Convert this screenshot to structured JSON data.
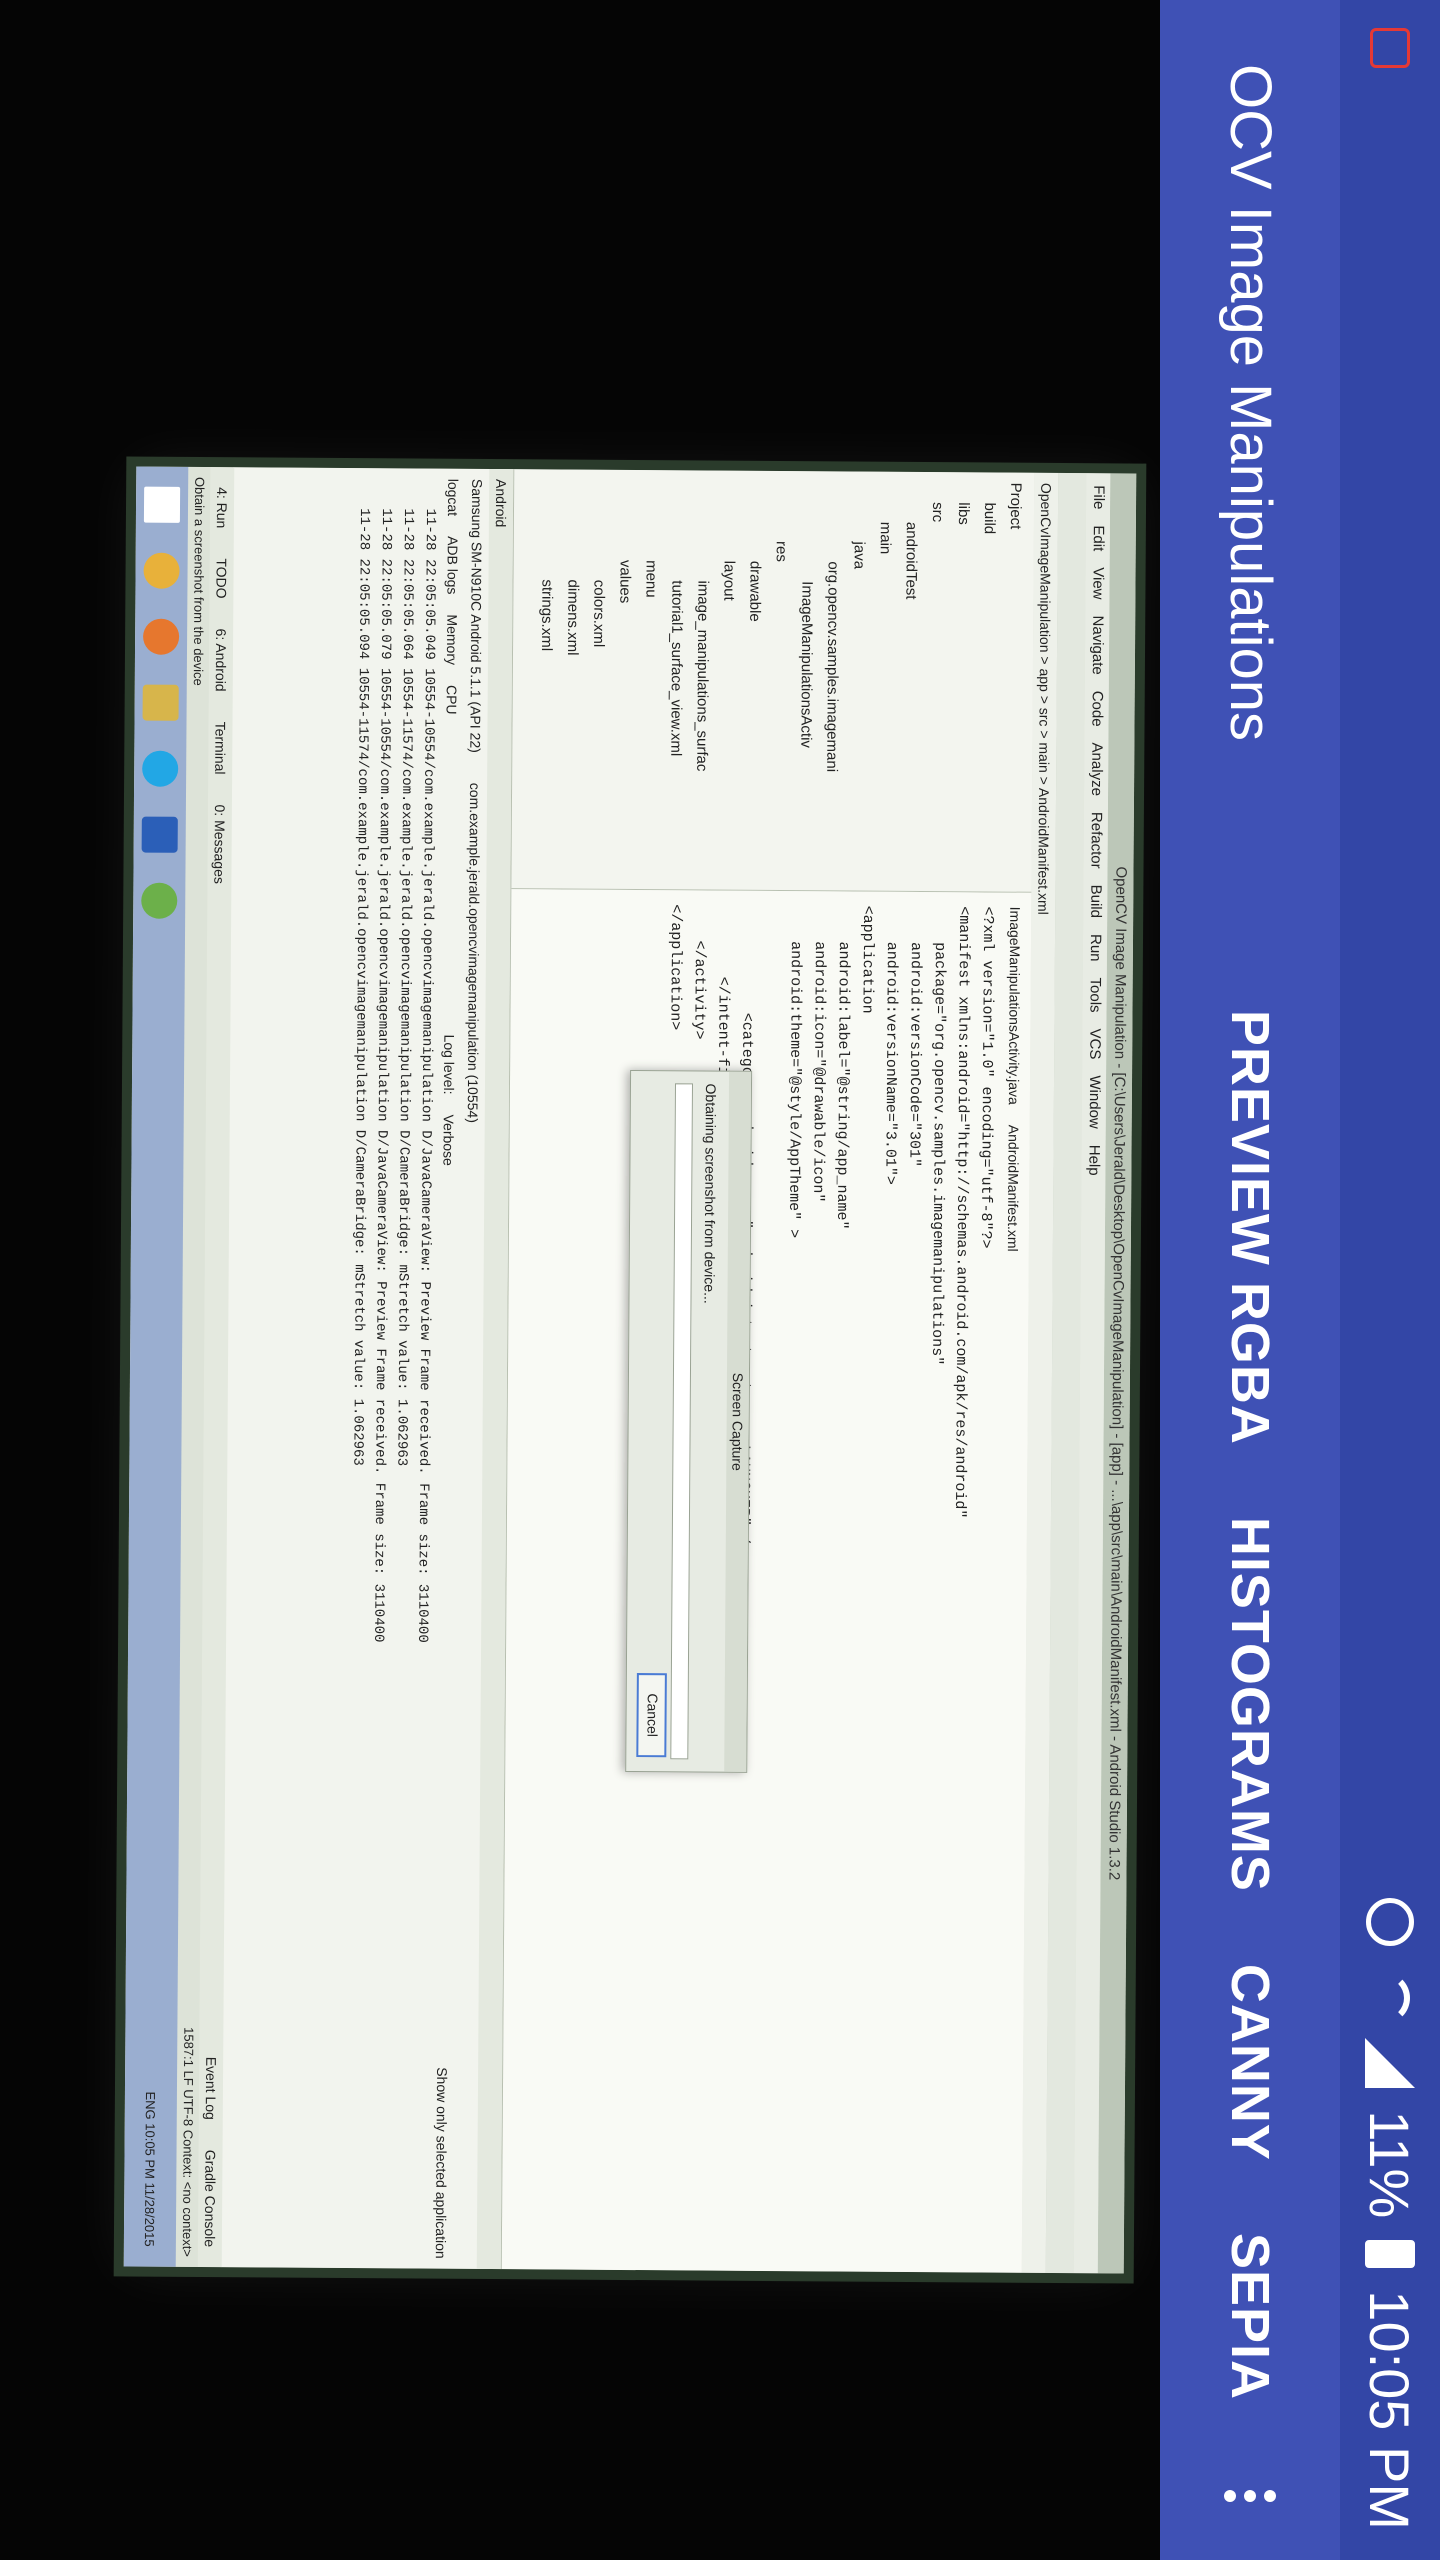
{
  "status_bar": {
    "battery": "11%",
    "time": "10:05 PM"
  },
  "app_bar": {
    "title": "OCV Image Manipulations",
    "actions": [
      "PREVIEW RGBA",
      "HISTOGRAMS",
      "CANNY",
      "SEPIA"
    ],
    "overflow_icon": "more-vert-icon"
  },
  "ide": {
    "title": "OpenCV Image Manipulation - [C:\\Users\\Jerald\\Desktop\\OpenCvImageManipulation] - [app] - ...\\app\\src\\main\\AndroidManifest.xml - Android Studio 1.3.2",
    "menu": [
      "File",
      "Edit",
      "View",
      "Navigate",
      "Code",
      "Analyze",
      "Refactor",
      "Build",
      "Run",
      "Tools",
      "VCS",
      "Window",
      "Help"
    ],
    "breadcrumb": "OpenCvImageManipulation > app > src > main > AndroidManifest.xml",
    "tree": [
      "Project",
      "build",
      "libs",
      "src",
      "androidTest",
      "main",
      "java",
      "org.opencv.samples.imagemani",
      "ImageManipulationsActiv",
      "res",
      "drawable",
      "layout",
      "image_manipulations_surfac",
      "tutorial1_surface_view.xml",
      "menu",
      "values",
      "colors.xml",
      "dimens.xml",
      "strings.xml"
    ],
    "tabs": [
      "ImageManipulationsActivity.java",
      "AndroidManifest.xml"
    ],
    "code": [
      "<?xml version=\"1.0\" encoding=\"utf-8\"?>",
      "<manifest xmlns:android=\"http://schemas.android.com/apk/res/android\"",
      "    package=\"org.opencv.samples.imagemanipulations\"",
      "    android:versionCode=\"301\"",
      "    android:versionName=\"3.01\">",
      "<application",
      "    android:label=\"@string/app_name\"",
      "    android:icon=\"@drawable/icon\"",
      "    android:theme=\"@style/AppTheme\" >",
      "",
      "            <category android:name=\"android.intent.category.LAUNCHER\" />",
      "        </intent-filter>",
      "    </activity>",
      "</application>"
    ],
    "dialog": {
      "title": "Screen Capture",
      "message": "Obtaining screenshot from device...",
      "cancel": "Cancel"
    },
    "android_panel": {
      "header": "Android",
      "device": "Samsung SM-N910C Android 5.1.1 (API 22)",
      "process": "com.example.jerald.opencvimagemanipulation (10554)",
      "tabs": [
        "logcat",
        "ADB logs",
        "Memory",
        "CPU"
      ],
      "log_level_label": "Log level:",
      "log_level": "Verbose",
      "filter": "Show only selected application",
      "logs": [
        "11-28 22:05:05.049  10554-10554/com.example.jerald.opencvimagemanipulation D/JavaCameraView: Preview Frame received. Frame size: 3110400",
        "11-28 22:05:05.064  10554-11574/com.example.jerald.opencvimagemanipulation D/CameraBridge: mStretch value: 1.062963",
        "11-28 22:05:05.079  10554-10554/com.example.jerald.opencvimagemanipulation D/JavaCameraView: Preview Frame received. Frame size: 3110400",
        "11-28 22:05:05.094  10554-11574/com.example.jerald.opencvimagemanipulation D/CameraBridge: mStretch value: 1.062963"
      ]
    },
    "bottom_tabs": [
      "4: Run",
      "TODO",
      "6: Android",
      "Terminal",
      "0: Messages"
    ],
    "status_left": "Obtain a screenshot from the device",
    "status_right": "1587:1  LF  UTF-8  Context: <no context>",
    "right_tabs": [
      "Event Log",
      "Gradle Console"
    ],
    "clock": "10:05 PM",
    "date": "11/28/2015",
    "lang": "ENG"
  }
}
